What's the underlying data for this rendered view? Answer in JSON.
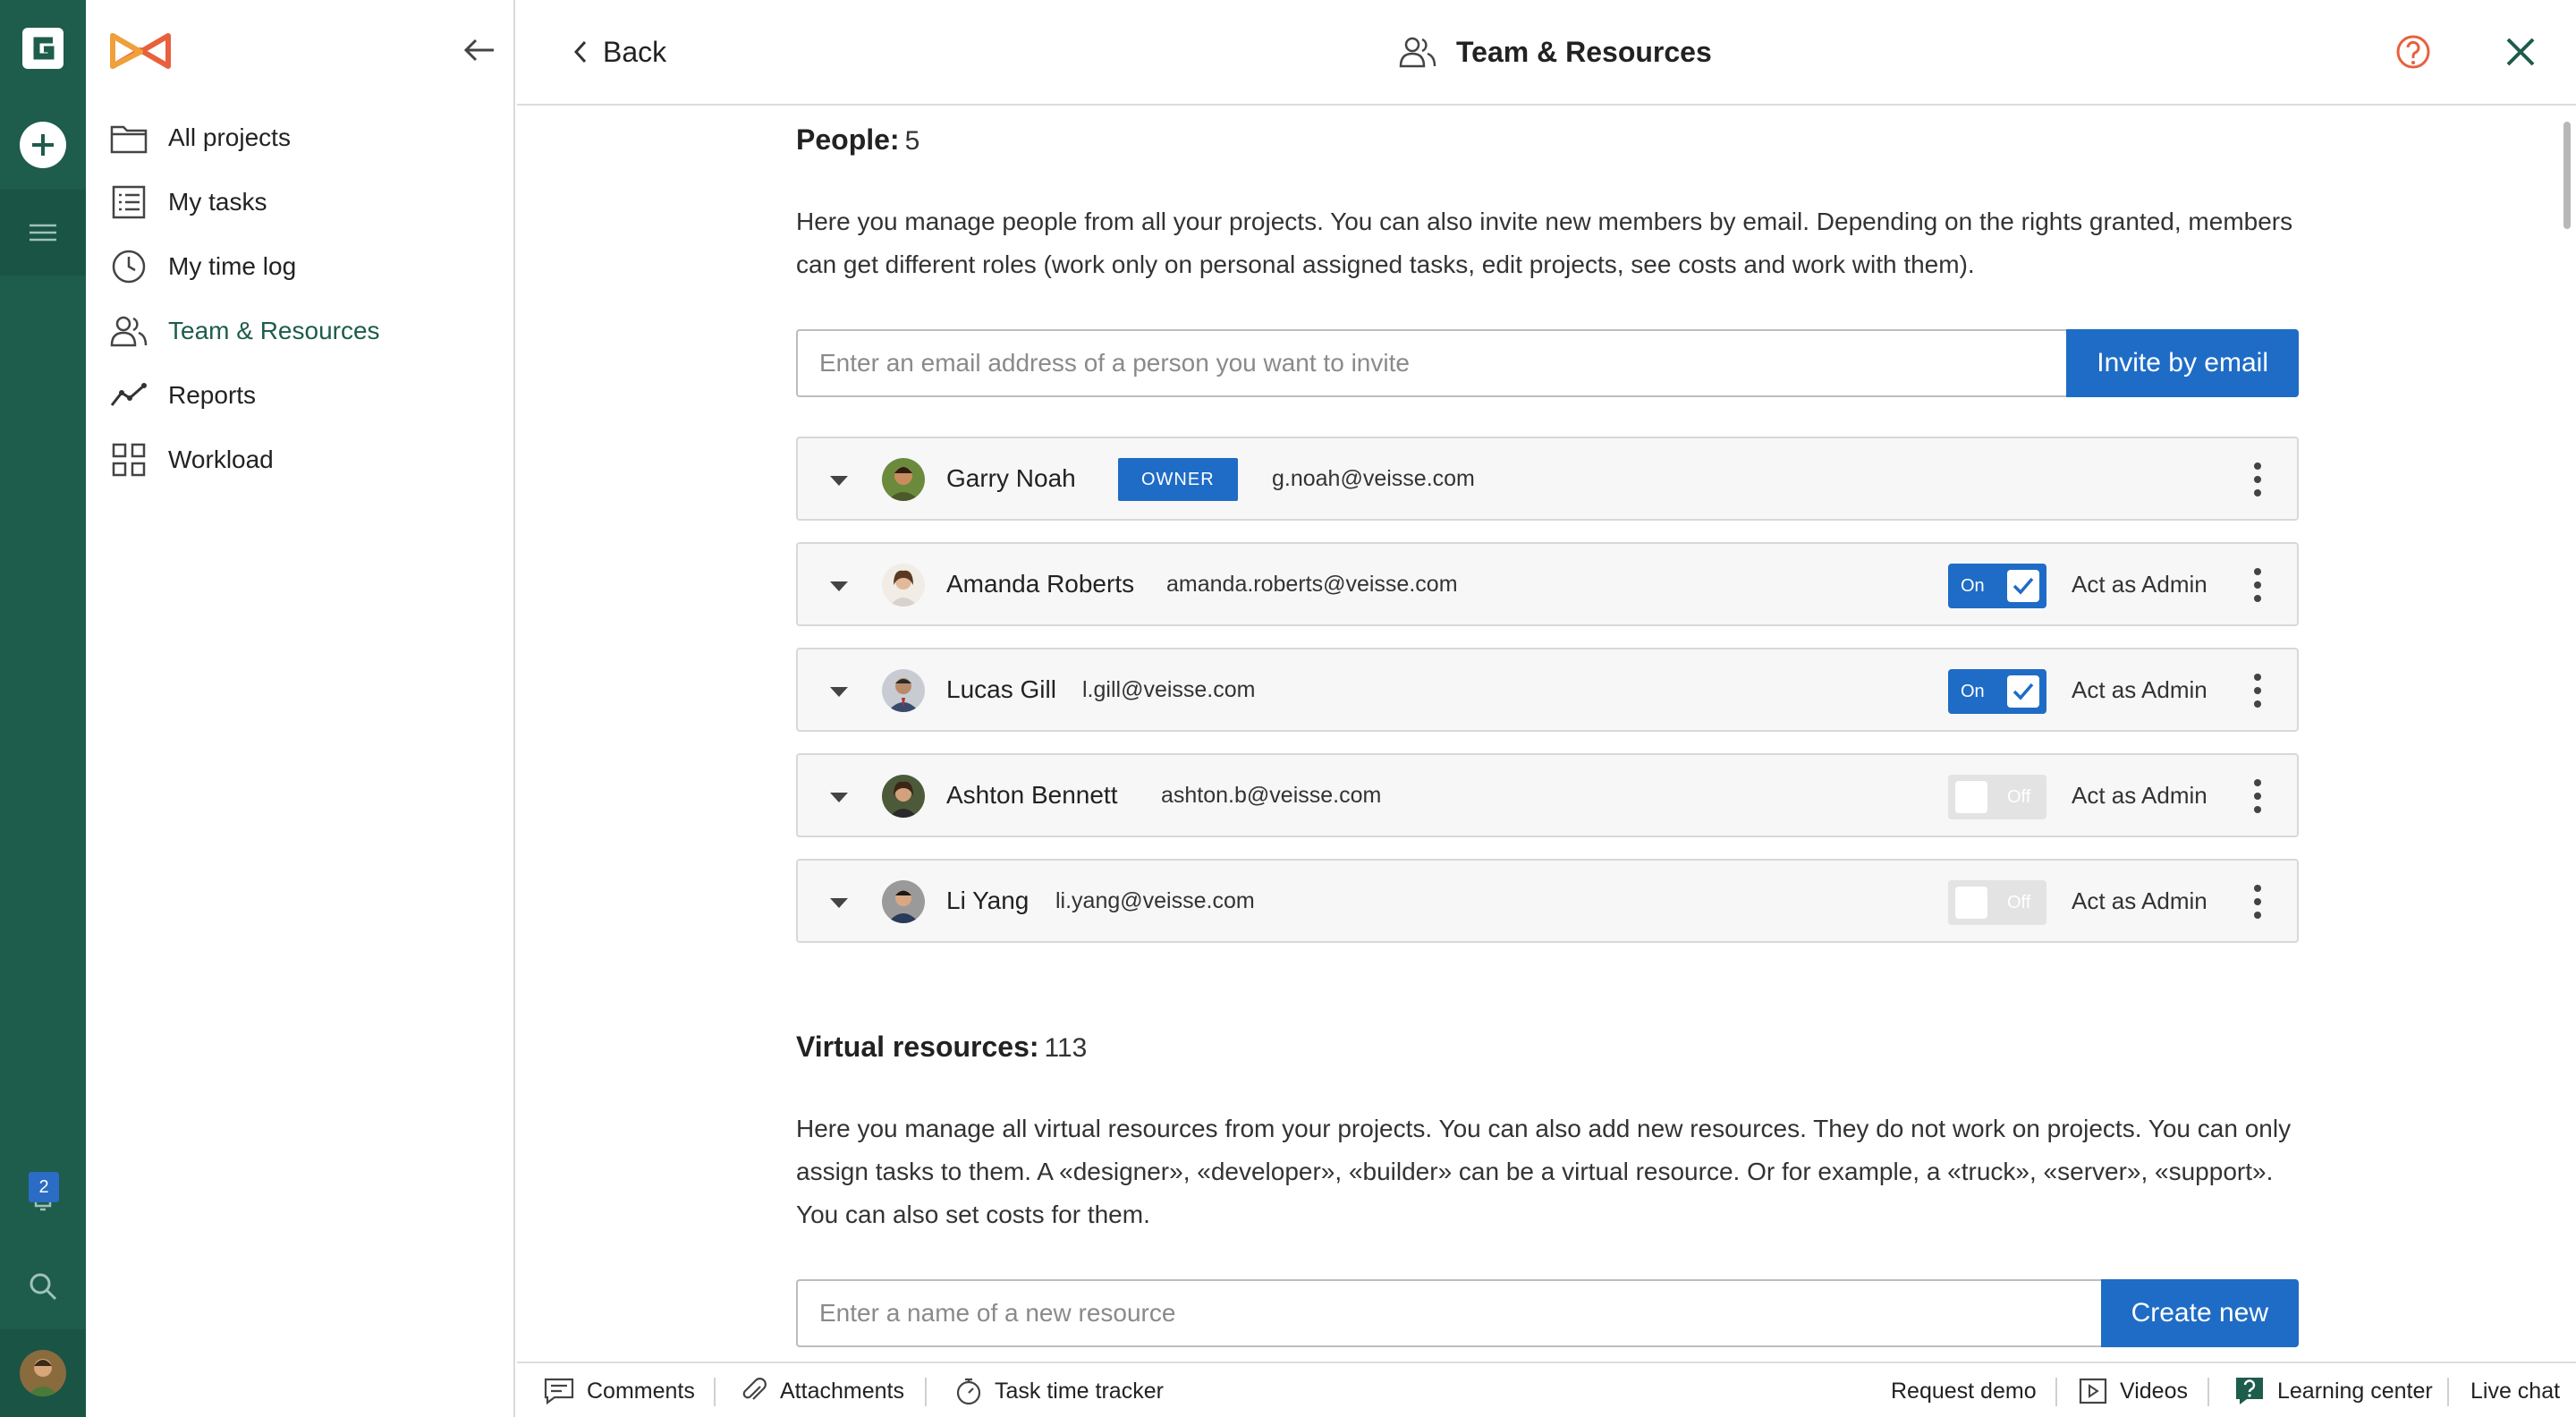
{
  "rail": {
    "notification_count": "2"
  },
  "sidebar": {
    "items": [
      {
        "label": "All projects",
        "icon": "folder-icon"
      },
      {
        "label": "My tasks",
        "icon": "list-icon"
      },
      {
        "label": "My time log",
        "icon": "clock-icon"
      },
      {
        "label": "Team & Resources",
        "icon": "people-icon",
        "active": true
      },
      {
        "label": "Reports",
        "icon": "chart-line-icon"
      },
      {
        "label": "Workload",
        "icon": "grid-icon"
      }
    ]
  },
  "header": {
    "back_label": "Back",
    "title": "Team & Resources"
  },
  "people": {
    "title": "People:",
    "count": "5",
    "description": "Here you manage people from all your projects. You can also invite new members by email. Depending on the rights granted, members can get different roles (work only on personal assigned tasks, edit projects, see costs and work with them).",
    "invite_placeholder": "Enter an email address of a person you want to invite",
    "invite_button": "Invite by email",
    "owner_badge": "OWNER",
    "admin_label": "Act as Admin",
    "toggle_on": "On",
    "toggle_off": "Off",
    "members": [
      {
        "name": "Garry Noah",
        "email": "g.noah@veisse.com",
        "owner": true
      },
      {
        "name": "Amanda Roberts",
        "email": "amanda.roberts@veisse.com",
        "admin": true
      },
      {
        "name": "Lucas Gill",
        "email": "l.gill@veisse.com",
        "admin": true
      },
      {
        "name": "Ashton Bennett",
        "email": "ashton.b@veisse.com",
        "admin": false
      },
      {
        "name": "Li Yang",
        "email": "li.yang@veisse.com",
        "admin": false
      }
    ]
  },
  "virtual": {
    "title": "Virtual resources:",
    "count": "113",
    "description": "Here you manage all virtual resources from your projects. You can also add new resources. They do not work on projects. You can only assign tasks to them. A «designer», «developer», «builder» can be a virtual resource. Or for example, a «truck», «server», «support». You can also set costs for them.",
    "resource_placeholder": "Enter a name of a new resource",
    "create_button": "Create new"
  },
  "footer": {
    "comments": "Comments",
    "attachments": "Attachments",
    "time_tracker": "Task time tracker",
    "request_demo": "Request demo",
    "videos": "Videos",
    "learning_center": "Learning center",
    "live_chat": "Live chat"
  },
  "colors": {
    "rail": "#1e5c4c",
    "accent": "#1f6cc6",
    "active_nav": "#1e5c4c"
  }
}
